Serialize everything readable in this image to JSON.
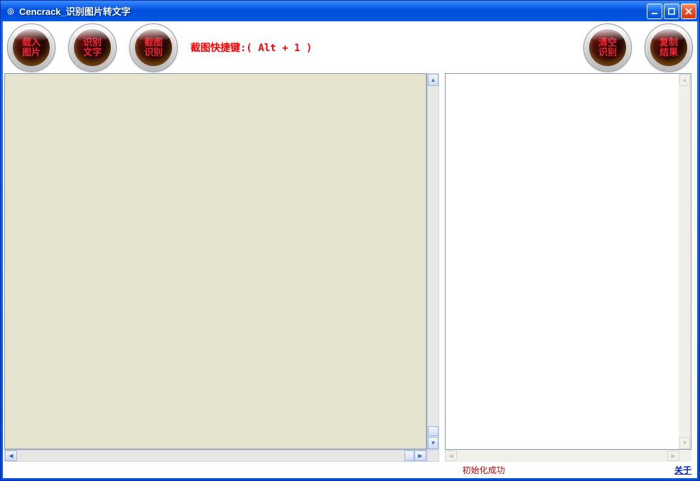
{
  "window": {
    "title": "Cencrack_识别图片转文字"
  },
  "toolbar": {
    "buttons": {
      "load_image": "载入\n图片",
      "recognize_text": "识别\n文字",
      "screenshot_recognize": "截图\n识别",
      "clear_recognition": "清空\n识别",
      "copy_result": "复制\n结果"
    },
    "shortcut_text": "截图快捷键:( Alt + 1 )"
  },
  "status": {
    "message": "初始化成功",
    "about": "关于"
  }
}
